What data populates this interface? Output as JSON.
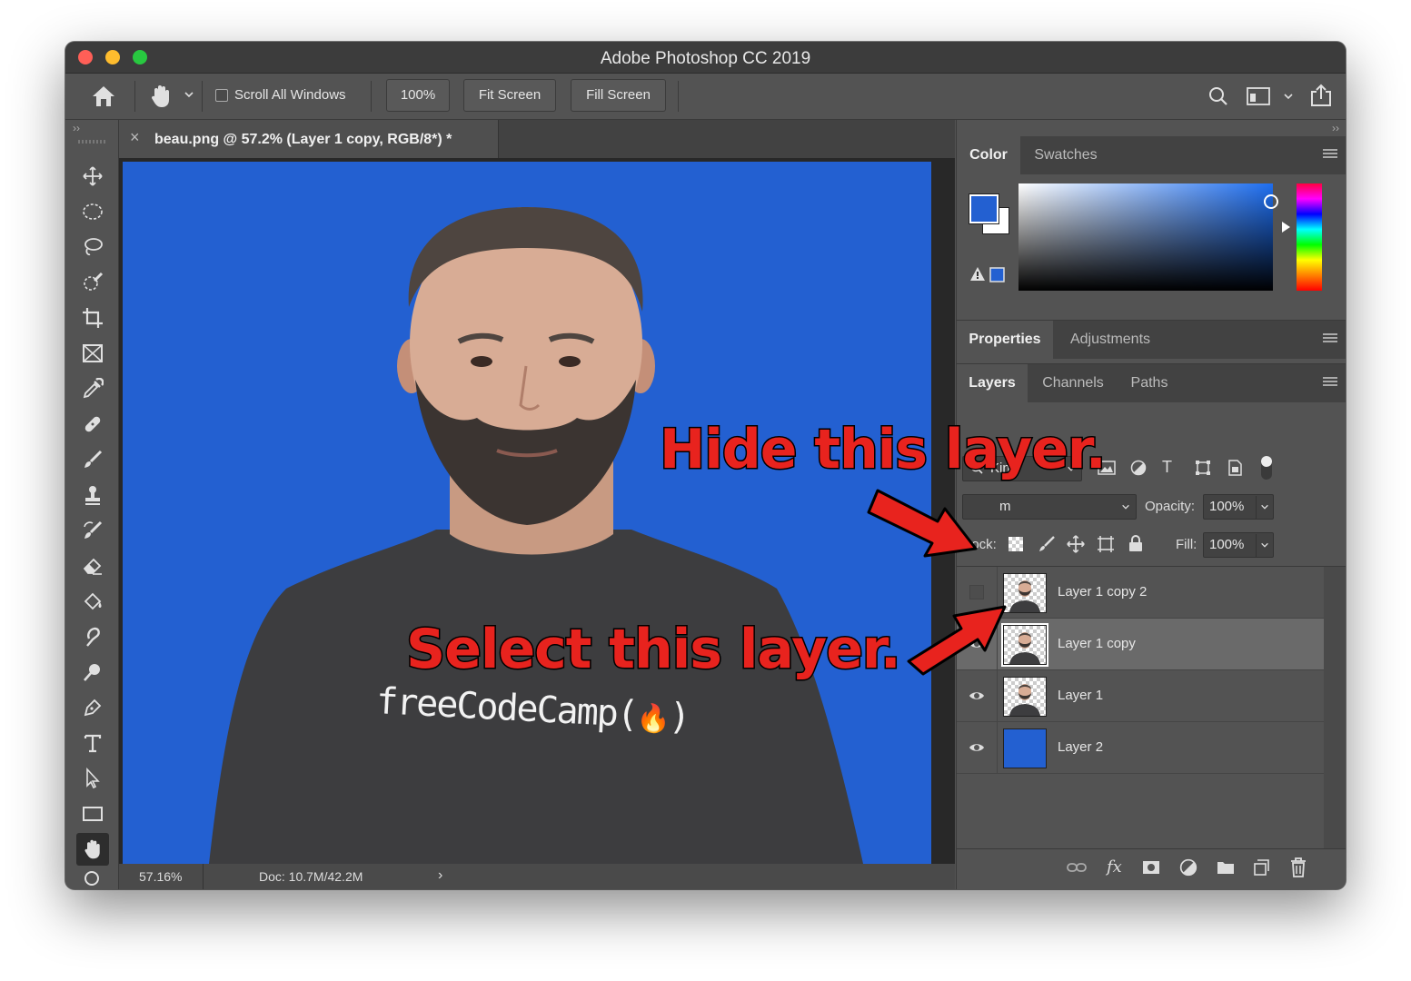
{
  "window": {
    "title": "Adobe Photoshop CC 2019",
    "traffic_colors": [
      "#ff5f57",
      "#febc2e",
      "#28c840"
    ]
  },
  "options_bar": {
    "scroll_all_windows_label": "Scroll All Windows",
    "scroll_all_windows_checked": false,
    "zoom_button": "100%",
    "fit_screen_button": "Fit Screen",
    "fill_screen_button": "Fill Screen"
  },
  "document": {
    "tab_title": "beau.png @ 57.2% (Layer 1 copy, RGB/8*) *",
    "close_glyph": "×",
    "zoom": "57.16%",
    "doc_info": "Doc: 10.7M/42.2M",
    "canvas_color": "#2360d1",
    "shirt_text": "freeCodeCamp(",
    "shirt_text_end": ")"
  },
  "color_panel": {
    "tabs": [
      "Color",
      "Swatches"
    ],
    "foreground": "#2360d1",
    "background": "#ffffff"
  },
  "properties_panel": {
    "tabs": [
      "Properties",
      "Adjustments"
    ]
  },
  "layers_panel": {
    "tabs": [
      "Layers",
      "Channels",
      "Paths"
    ],
    "filter_kind": "Kind",
    "blend_mode_partial": "m",
    "opacity_label": "Opacity:",
    "opacity": "100%",
    "lock_label": "Lock:",
    "fill_label": "Fill:",
    "fill": "100%",
    "layers": [
      {
        "name": "Layer 1 copy 2",
        "visible": false,
        "selected": false
      },
      {
        "name": "Layer 1 copy",
        "visible": true,
        "selected": true
      },
      {
        "name": "Layer 1",
        "visible": true,
        "selected": false
      },
      {
        "name": "Layer 2",
        "visible": true,
        "selected": false
      }
    ]
  },
  "annotations": {
    "hide": "Hide this layer.",
    "select": "Select this layer.",
    "color": "#e8231e"
  }
}
